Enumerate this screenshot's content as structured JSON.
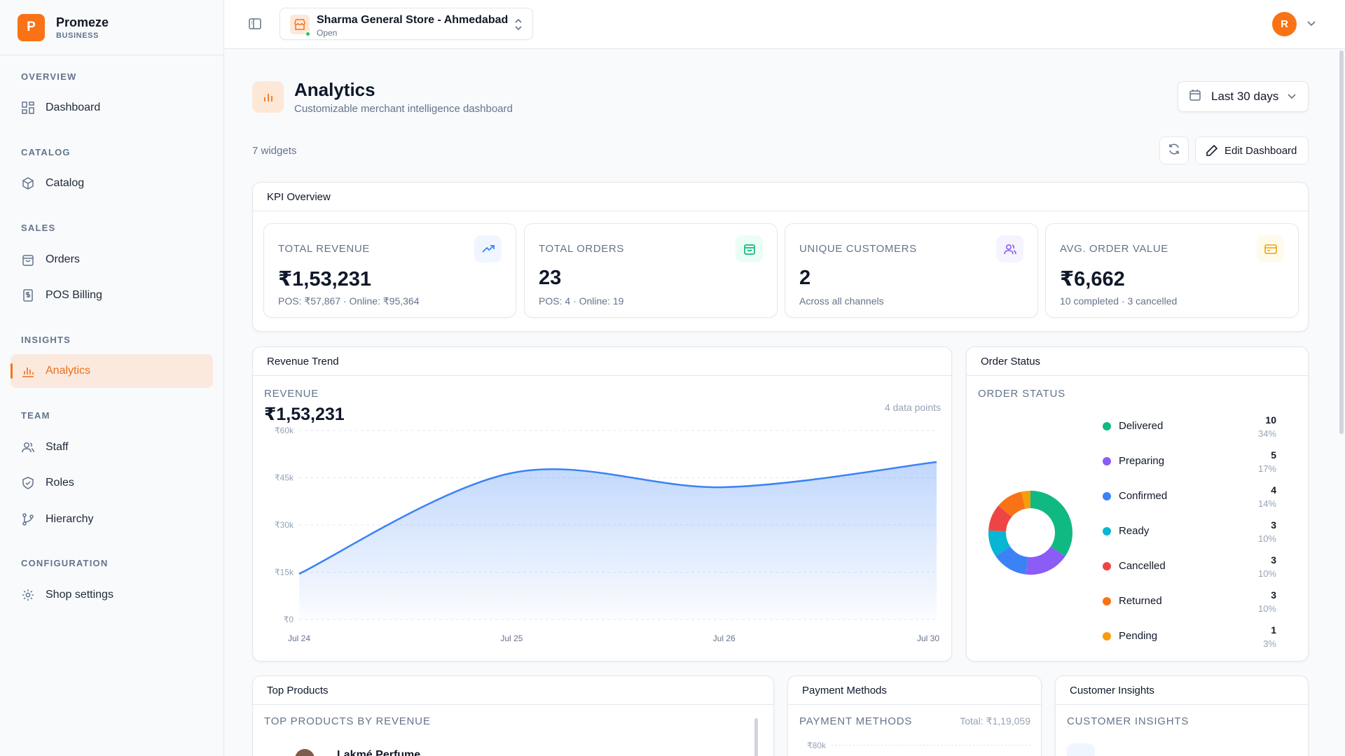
{
  "brand": {
    "logo_letter": "P",
    "name": "Promeze",
    "sub": "BUSINESS"
  },
  "sidebar": {
    "sections": [
      {
        "title": "OVERVIEW",
        "items": [
          {
            "label": "Dashboard",
            "icon": "grid-icon"
          }
        ]
      },
      {
        "title": "CATALOG",
        "items": [
          {
            "label": "Catalog",
            "icon": "box-icon"
          }
        ]
      },
      {
        "title": "SALES",
        "items": [
          {
            "label": "Orders",
            "icon": "bag-icon"
          },
          {
            "label": "POS Billing",
            "icon": "receipt-icon"
          }
        ]
      },
      {
        "title": "INSIGHTS",
        "items": [
          {
            "label": "Analytics",
            "icon": "bar-chart-icon",
            "active": true
          }
        ]
      },
      {
        "title": "TEAM",
        "items": [
          {
            "label": "Staff",
            "icon": "users-icon"
          },
          {
            "label": "Roles",
            "icon": "shield-icon"
          },
          {
            "label": "Hierarchy",
            "icon": "branch-icon"
          }
        ]
      },
      {
        "title": "CONFIGURATION",
        "items": [
          {
            "label": "Shop settings",
            "icon": "gear-icon"
          }
        ]
      }
    ]
  },
  "topbar": {
    "store_name": "Sharma General Store - Ahmedabad",
    "store_status": "Open",
    "avatar_letter": "R"
  },
  "page": {
    "title": "Analytics",
    "subtitle": "Customizable merchant intelligence dashboard",
    "range_label": "Last 30 days",
    "widgets_count": "7 widgets",
    "edit_label": "Edit Dashboard"
  },
  "kpi": {
    "title": "KPI Overview",
    "cards": [
      {
        "label": "TOTAL REVENUE",
        "value": "₹1,53,231",
        "sub": "POS: ₹57,867 · Online: ₹95,364",
        "icon": "trending-up-icon",
        "color": "#3b82f6",
        "bg": "#eff6ff"
      },
      {
        "label": "TOTAL ORDERS",
        "value": "23",
        "sub": "POS: 4 · Online: 19",
        "icon": "bag-icon",
        "color": "#10b981",
        "bg": "#ecfdf5"
      },
      {
        "label": "UNIQUE CUSTOMERS",
        "value": "2",
        "sub": "Across all channels",
        "icon": "users-icon",
        "color": "#8b5cf6",
        "bg": "#f5f3ff"
      },
      {
        "label": "AVG. ORDER VALUE",
        "value": "₹6,662",
        "sub": "10 completed · 3 cancelled",
        "icon": "card-icon",
        "color": "#f59e0b",
        "bg": "#fffbeb"
      }
    ]
  },
  "revenue": {
    "title": "Revenue Trend",
    "label": "REVENUE",
    "total": "₹1,53,231",
    "points_label": "4 data points"
  },
  "chart_data": [
    {
      "type": "area",
      "title": "",
      "xlabel": "",
      "ylabel": "",
      "x": [
        "Jul 24",
        "Jul 25",
        "Jul 26",
        "Jul 30"
      ],
      "series": [
        {
          "values": [
            14500,
            46500,
            42000,
            50000
          ]
        }
      ],
      "yticks": [
        "₹0",
        "₹15k",
        "₹30k",
        "₹45k",
        "₹60k"
      ],
      "ylim": [
        0,
        60000
      ],
      "grid": true,
      "color": "#3b82f6"
    },
    {
      "type": "pie",
      "title": "",
      "donut": true,
      "categories": [
        "Delivered",
        "Preparing",
        "Confirmed",
        "Ready",
        "Cancelled",
        "Returned",
        "Pending"
      ],
      "values": [
        10,
        5,
        4,
        3,
        3,
        3,
        1
      ],
      "percents": [
        "34%",
        "17%",
        "14%",
        "10%",
        "10%",
        "10%",
        "3%"
      ],
      "colors": [
        "#10b981",
        "#8b5cf6",
        "#3b82f6",
        "#06b6d4",
        "#ef4444",
        "#f97316",
        "#f59e0b"
      ]
    }
  ],
  "order_status": {
    "title": "Order Status",
    "label": "ORDER STATUS"
  },
  "bottom": {
    "top_products": {
      "title": "Top Products",
      "label": "TOP PRODUCTS BY REVENUE",
      "first_item": "Lakmé Perfume"
    },
    "payment_methods": {
      "title": "Payment Methods",
      "label": "PAYMENT METHODS",
      "total": "Total: ₹1,19,059",
      "first_tick": "₹80k"
    },
    "customer_insights": {
      "title": "Customer Insights",
      "label": "CUSTOMER INSIGHTS"
    }
  }
}
